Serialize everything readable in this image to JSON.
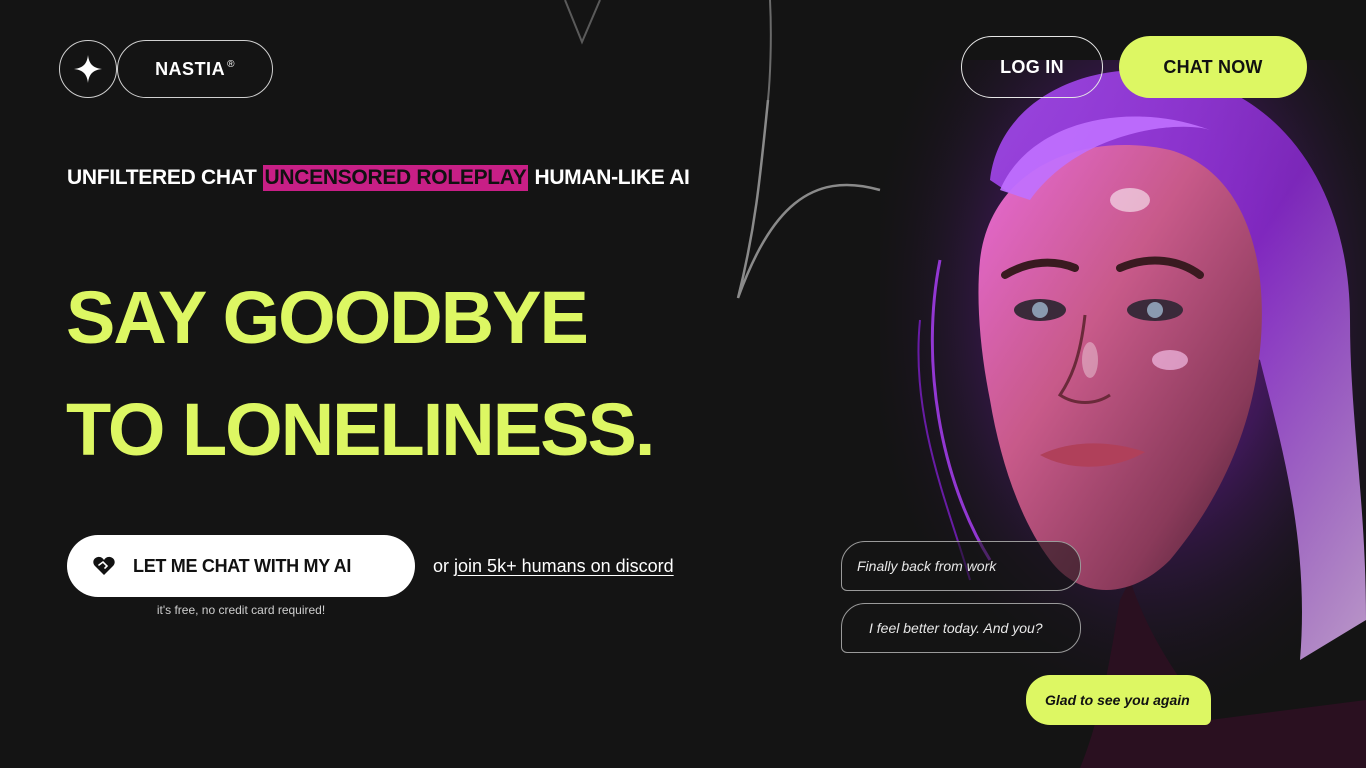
{
  "brand": {
    "name": "NASTIA",
    "mark": "®",
    "logo_icon": "sparkle-icon"
  },
  "header": {
    "login_label": "LOG IN",
    "chat_now_label": "CHAT NOW"
  },
  "tagline": {
    "part1": "UNFILTERED CHAT",
    "highlight": "UNCENSORED ROLEPLAY",
    "part2": "HUMAN-LIKE AI"
  },
  "headline": {
    "line1": "SAY GOODBYE",
    "line2": "TO LONELINESS."
  },
  "cta": {
    "label": "LET ME CHAT WITH MY AI",
    "icon": "heart-handshake-icon",
    "note": "it's free, no credit card required!",
    "or_text": "or",
    "discord_link": "join 5k+ humans on discord"
  },
  "chat_bubbles": {
    "msg1": "Finally back from work",
    "msg2": "I feel better today. And you?",
    "msg3": "Glad to see you again"
  },
  "colors": {
    "background": "#141414",
    "accent_lime": "#ddf763",
    "highlight_magenta": "#c81f86",
    "portrait_purple": "#a020f0"
  }
}
